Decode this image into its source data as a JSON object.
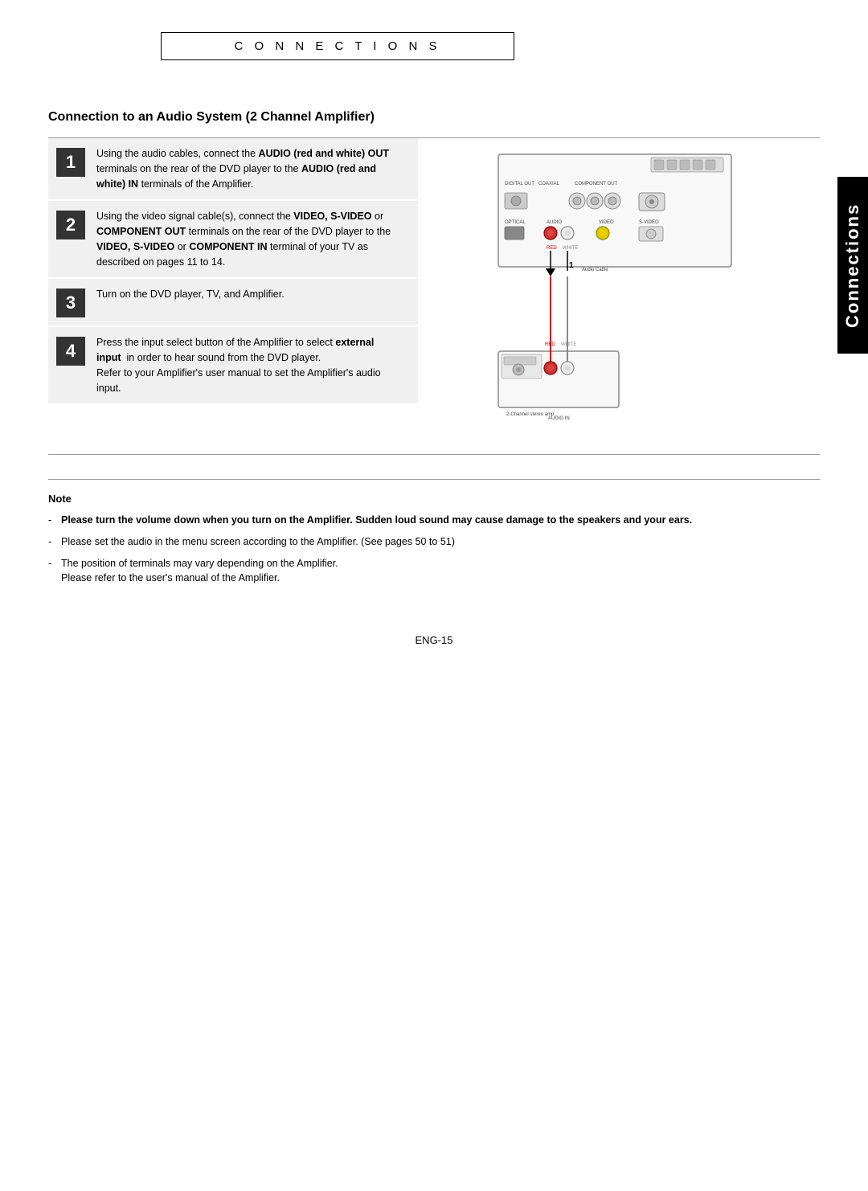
{
  "header": {
    "title": "C O N N E C T I O N S"
  },
  "side_tab": {
    "label": "Connections"
  },
  "section": {
    "heading": "Connection to an Audio System (2 Channel Amplifier)"
  },
  "steps": [
    {
      "number": "1",
      "text_parts": [
        {
          "type": "normal",
          "text": "Using the audio cables, connect the "
        },
        {
          "type": "bold",
          "text": "AUDIO (red and white) OUT"
        },
        {
          "type": "normal",
          "text": " terminals on the rear of the DVD player to the "
        },
        {
          "type": "bold",
          "text": "AUDIO (red and white) IN"
        },
        {
          "type": "normal",
          "text": " terminals of the Amplifier."
        }
      ]
    },
    {
      "number": "2",
      "text_parts": [
        {
          "type": "normal",
          "text": "Using the video signal cable(s), connect the "
        },
        {
          "type": "bold",
          "text": "VIDEO, S-VIDEO"
        },
        {
          "type": "normal",
          "text": " or "
        },
        {
          "type": "bold",
          "text": "COMPONENT OUT"
        },
        {
          "type": "normal",
          "text": " terminals on the rear of the DVD player to the "
        },
        {
          "type": "bold",
          "text": "VIDEO, S-VIDEO"
        },
        {
          "type": "normal",
          "text": " or "
        },
        {
          "type": "bold",
          "text": "COMPONENT IN"
        },
        {
          "type": "normal",
          "text": " terminal of your TV as described on pages 11 to 14."
        }
      ]
    },
    {
      "number": "3",
      "text_parts": [
        {
          "type": "normal",
          "text": "Turn on the DVD player, TV, and Amplifier."
        }
      ]
    },
    {
      "number": "4",
      "text_parts": [
        {
          "type": "normal",
          "text": "Press the input select button of the Amplifier to select "
        },
        {
          "type": "bold",
          "text": "external input"
        },
        {
          "type": "normal",
          "text": "  in order to hear sound from the DVD player.\nRefer to your Amplifier's user manual to set the Amplifier's audio input."
        }
      ]
    }
  ],
  "notes": {
    "title": "Note",
    "items": [
      {
        "bold_part": "Please turn the volume down when you turn on the Amplifier. Sudden loud sound may cause damage to the speakers and your ears.",
        "normal_part": ""
      },
      {
        "bold_part": "",
        "normal_part": "Please set the audio in the menu screen according to the Amplifier. (See pages 50 to 51)"
      },
      {
        "bold_part": "",
        "normal_part": "The position of terminals may vary depending on the Amplifier.\nPlease refer to the user's manual of the Amplifier."
      }
    ]
  },
  "page_number": "ENG-15"
}
